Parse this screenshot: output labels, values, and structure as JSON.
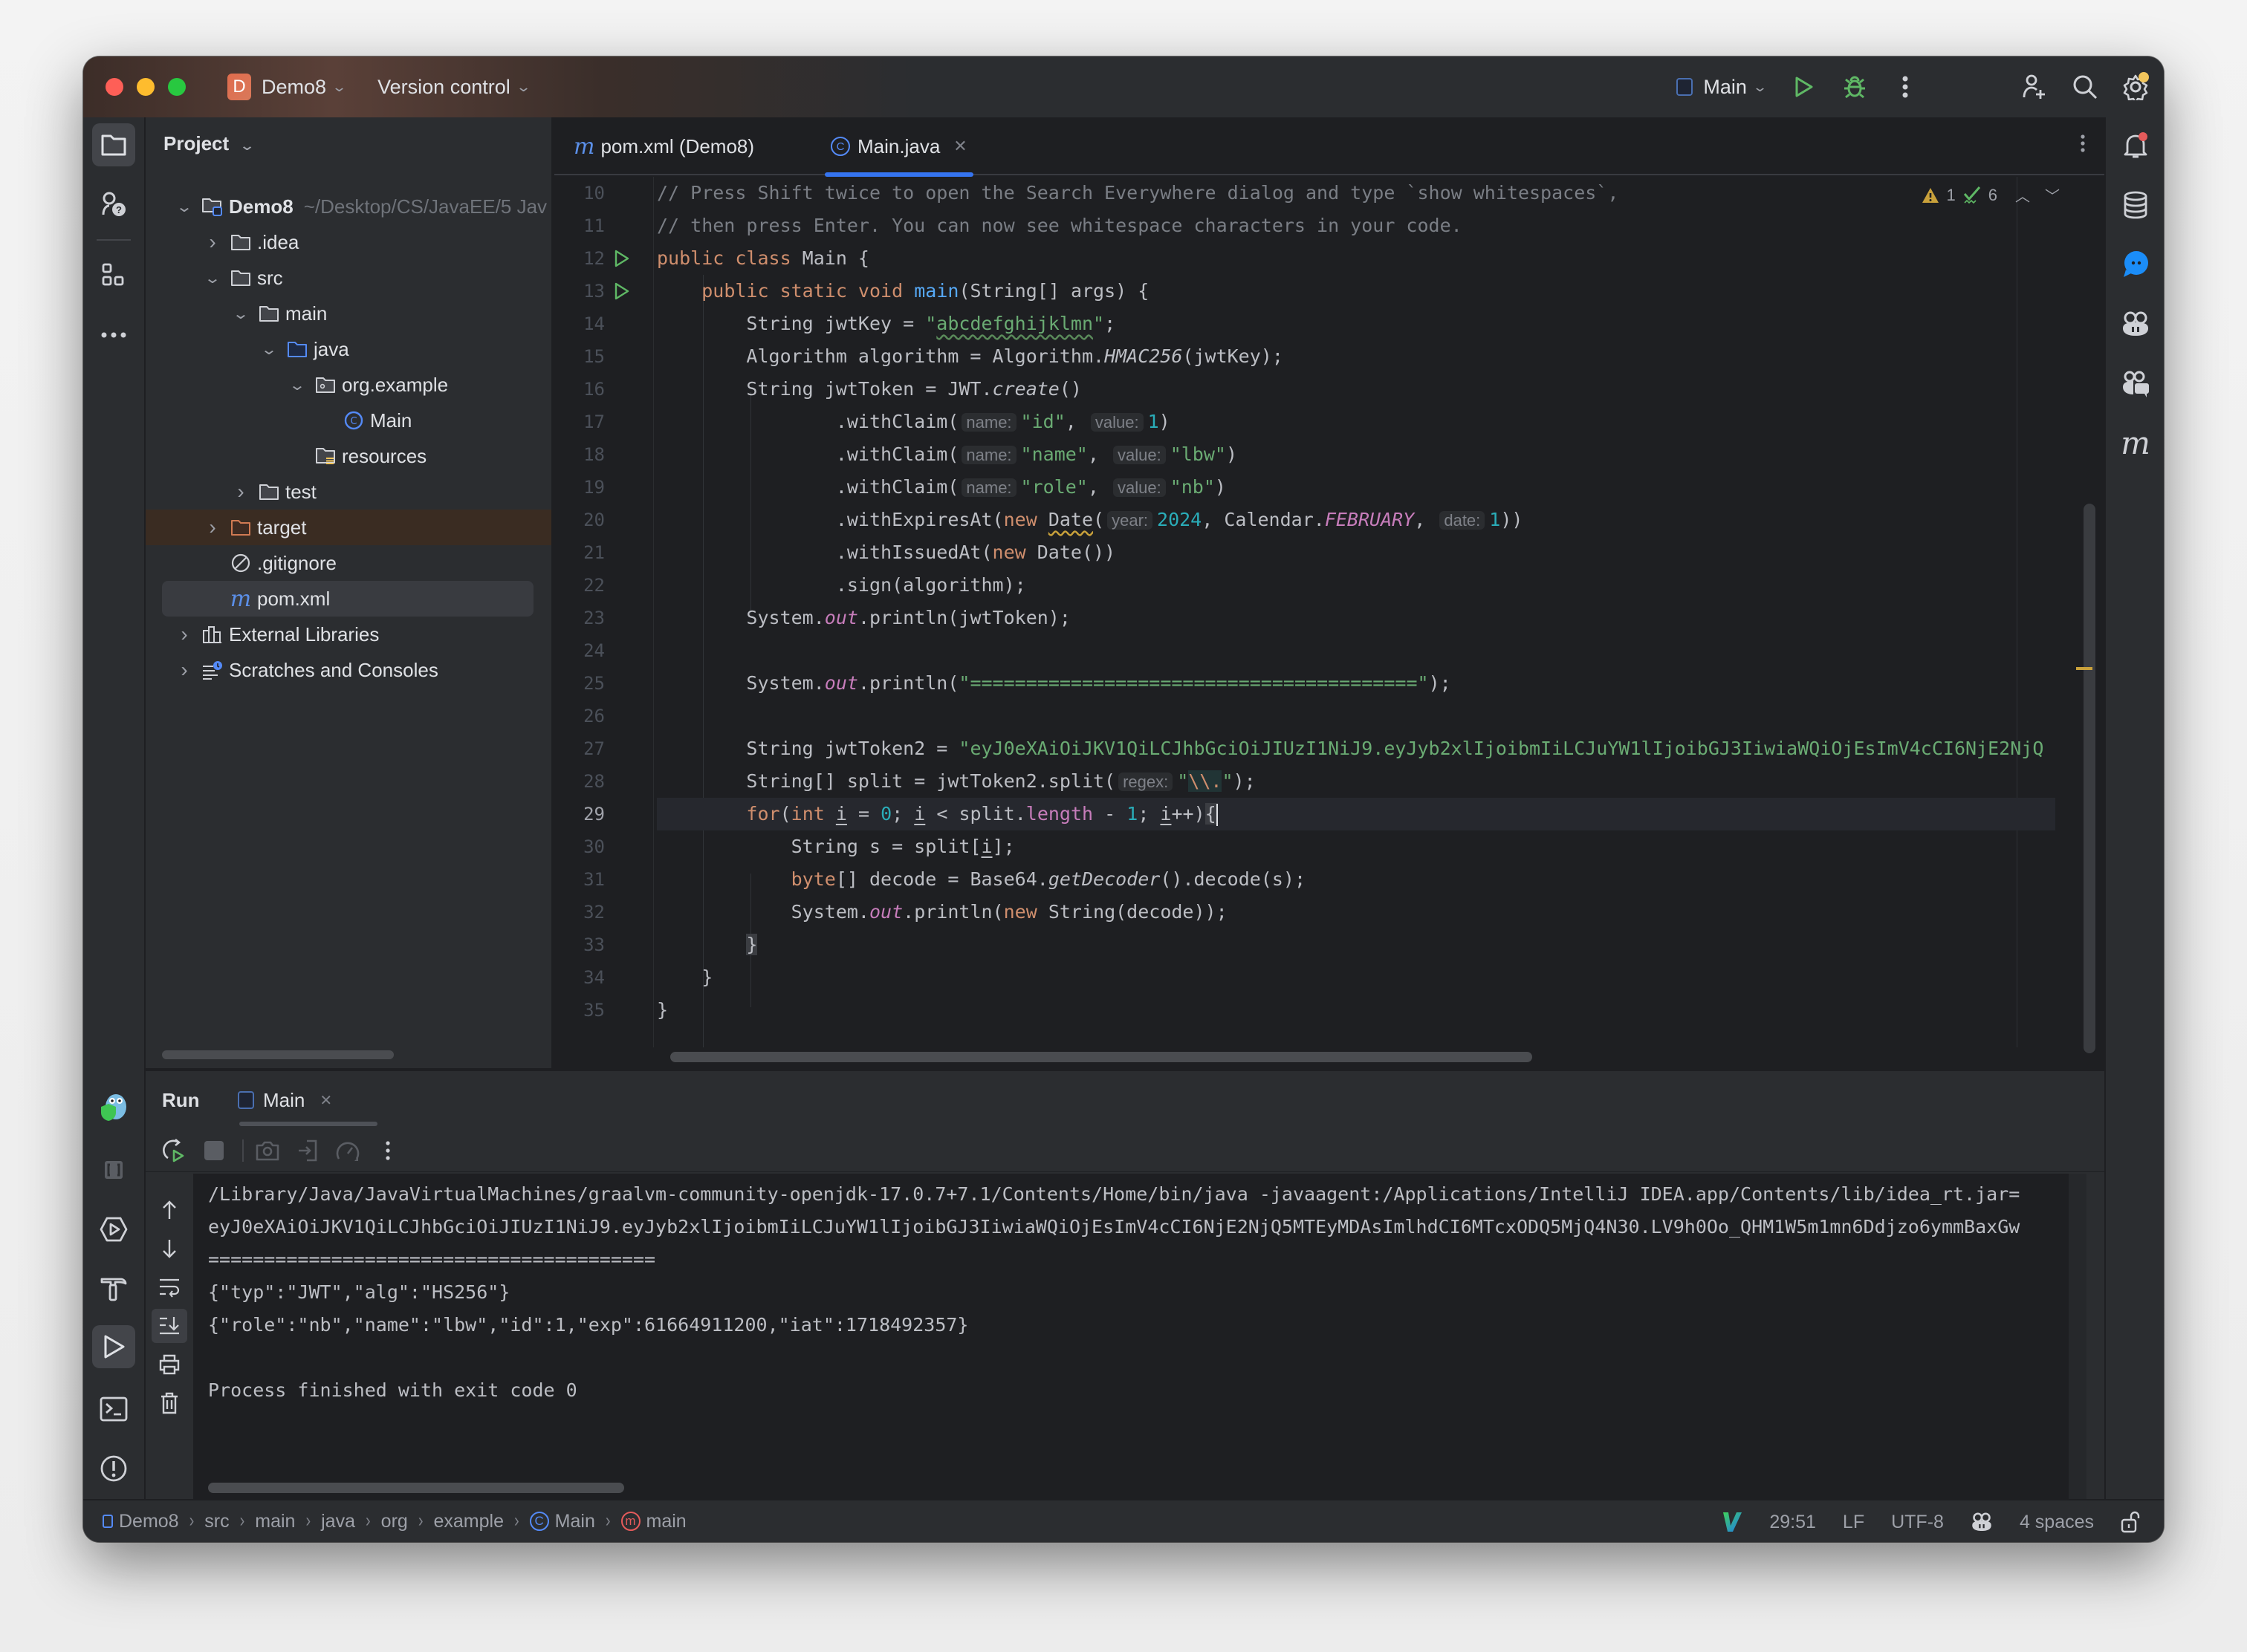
{
  "titlebar": {
    "project_badge": "D",
    "project_name": "Demo8",
    "vcs_label": "Version control",
    "run_config": "Main",
    "actions": [
      "run-icon",
      "debug-icon",
      "more-icon",
      "add-user-icon",
      "search-icon",
      "settings-icon"
    ]
  },
  "left_strip": {
    "items": [
      "project-icon",
      "learn-icon",
      "structure-icon",
      "more-icon",
      "gopher-plugin-icon",
      "bookmarks-icon",
      "services-icon",
      "build-icon",
      "run-icon",
      "terminal-icon",
      "problems-icon",
      "git-icon"
    ]
  },
  "project_panel": {
    "title": "Project",
    "tree": [
      {
        "label": "Demo8",
        "path": "~/Desktop/CS/JavaEE/5 Jav",
        "depth": 0,
        "expanded": true,
        "icon": "module-folder-icon",
        "bold": true
      },
      {
        "label": ".idea",
        "depth": 1,
        "expanded": false,
        "icon": "folder-icon"
      },
      {
        "label": "src",
        "depth": 1,
        "expanded": true,
        "icon": "folder-icon"
      },
      {
        "label": "main",
        "depth": 2,
        "expanded": true,
        "icon": "folder-icon"
      },
      {
        "label": "java",
        "depth": 3,
        "expanded": true,
        "icon": "source-folder-icon"
      },
      {
        "label": "org.example",
        "depth": 4,
        "expanded": true,
        "icon": "package-icon"
      },
      {
        "label": "Main",
        "depth": 5,
        "icon": "class-icon"
      },
      {
        "label": "resources",
        "depth": 4,
        "icon": "resources-folder-icon"
      },
      {
        "label": "test",
        "depth": 2,
        "expanded": false,
        "icon": "folder-icon"
      },
      {
        "label": "target",
        "depth": 1,
        "expanded": false,
        "icon": "excluded-folder-icon",
        "excluded": true
      },
      {
        "label": ".gitignore",
        "depth": 1,
        "icon": "ignore-file-icon"
      },
      {
        "label": "pom.xml",
        "depth": 1,
        "icon": "maven-icon",
        "selected": true
      },
      {
        "label": "External Libraries",
        "depth": 0,
        "expanded": false,
        "icon": "libraries-icon"
      },
      {
        "label": "Scratches and Consoles",
        "depth": 0,
        "expanded": false,
        "icon": "scratches-icon"
      }
    ]
  },
  "editor": {
    "tabs": [
      {
        "label": "pom.xml (Demo8)",
        "icon": "maven-icon",
        "active": false
      },
      {
        "label": "Main.java",
        "icon": "class-icon",
        "active": true,
        "closable": true
      }
    ],
    "inspections": {
      "warnings": "1",
      "typos": "6"
    },
    "current_line": 29,
    "lines": [
      {
        "n": 10,
        "text": "// Press Shift twice to open the Search Everywhere dialog and type `show whitespaces`,"
      },
      {
        "n": 11,
        "text": "// then press Enter. You can now see whitespace characters in your code."
      },
      {
        "n": 12,
        "text": "public class Main {"
      },
      {
        "n": 13,
        "text": "    public static void main(String[] args) {"
      },
      {
        "n": 14,
        "text": "        String jwtKey = \"abcdefghijklmn\";"
      },
      {
        "n": 15,
        "text": "        Algorithm algorithm = Algorithm.HMAC256(jwtKey);"
      },
      {
        "n": 16,
        "text": "        String jwtToken = JWT.create()"
      },
      {
        "n": 17,
        "text": "                .withClaim(name: \"id\", value: 1)"
      },
      {
        "n": 18,
        "text": "                .withClaim(name: \"name\", value: \"lbw\")"
      },
      {
        "n": 19,
        "text": "                .withClaim(name: \"role\", value: \"nb\")"
      },
      {
        "n": 20,
        "text": "                .withExpiresAt(new Date(year: 2024, Calendar.FEBRUARY, date: 1))"
      },
      {
        "n": 21,
        "text": "                .withIssuedAt(new Date())"
      },
      {
        "n": 22,
        "text": "                .sign(algorithm);"
      },
      {
        "n": 23,
        "text": "        System.out.println(jwtToken);"
      },
      {
        "n": 24,
        "text": ""
      },
      {
        "n": 25,
        "text": "        System.out.println(\"========================================\");"
      },
      {
        "n": 26,
        "text": ""
      },
      {
        "n": 27,
        "text": "        String jwtToken2 = \"eyJ0eXAiOiJKV1QiLCJhbGciOiJIUzI1NiJ9.eyJyb2xlIjoibmIiLCJuYW1lIjoibGJ3IiwiaWQiOjEsImV4cCI6NjE2NjQ"
      },
      {
        "n": 28,
        "text": "        String[] split = jwtToken2.split(regex: \"\\\\.\");"
      },
      {
        "n": 29,
        "text": "        for(int i = 0; i < split.length - 1; i++){"
      },
      {
        "n": 30,
        "text": "            String s = split[i];"
      },
      {
        "n": 31,
        "text": "            byte[] decode = Base64.getDecoder().decode(s);"
      },
      {
        "n": 32,
        "text": "            System.out.println(new String(decode));"
      },
      {
        "n": 33,
        "text": "        }"
      },
      {
        "n": 34,
        "text": "    }"
      },
      {
        "n": 35,
        "text": "}"
      }
    ],
    "tokens": {
      "l10": "// Press Shift twice to open the Search Everywhere dialog and type `show whitespaces`,",
      "l11": "// then press Enter. You can now see whitespace characters in your code.",
      "jwtKey_value": "abcdefghijklmn",
      "hmac": "HMAC256",
      "create": "create",
      "claims": [
        {
          "name": "\"id\"",
          "value": "1",
          "value_type": "num"
        },
        {
          "name": "\"name\"",
          "value": "\"lbw\"",
          "value_type": "str"
        },
        {
          "name": "\"role\"",
          "value": "\"nb\"",
          "value_type": "str"
        }
      ],
      "hint_name": "name:",
      "hint_value": "value:",
      "hint_year": "year:",
      "hint_date": "date:",
      "hint_regex": "regex:",
      "year": "2024",
      "month": "FEBRUARY",
      "day": "1",
      "separator": "\"========================================\"",
      "jwt2": "\"eyJ0eXAiOiJKV1QiLCJhbGciOiJIUzI1NiJ9.eyJyb2xlIjoibmIiLCJuYW1lIjoibGJ3IiwiaWQiOjEsImV4cCI6NjE2NjQ"
    }
  },
  "run_panel": {
    "title": "Run",
    "tab_label": "Main",
    "toolbar": [
      "rerun-icon",
      "stop-icon",
      "screenshot-icon",
      "exit-icon",
      "profiler-icon",
      "more-icon"
    ],
    "side_actions": [
      "scroll-up-icon",
      "scroll-down-icon",
      "soft-wrap-icon",
      "scroll-to-end-icon",
      "print-icon",
      "clear-icon"
    ],
    "output": [
      "/Library/Java/JavaVirtualMachines/graalvm-community-openjdk-17.0.7+7.1/Contents/Home/bin/java -javaagent:/Applications/IntelliJ IDEA.app/Contents/lib/idea_rt.jar=",
      "eyJ0eXAiOiJKV1QiLCJhbGciOiJIUzI1NiJ9.eyJyb2xlIjoibmIiLCJuYW1lIjoibGJ3IiwiaWQiOjEsImV4cCI6NjE2NjQ5MTEyMDAsImlhdCI6MTcxODQ5MjQ4N30.LV9h0Oo_QHM1W5m1mn6Ddjzo6ymmBaxGw",
      "========================================",
      "{\"typ\":\"JWT\",\"alg\":\"HS256\"}",
      "{\"role\":\"nb\",\"name\":\"lbw\",\"id\":1,\"exp\":61664911200,\"iat\":1718492357}",
      "",
      "Process finished with exit code 0"
    ]
  },
  "right_strip": {
    "items": [
      "notifications-icon",
      "database-icon",
      "chat-icon",
      "copilot-icon",
      "copilot-chat-icon",
      "maven-icon"
    ]
  },
  "statusbar": {
    "breadcrumbs": [
      "Demo8",
      "src",
      "main",
      "java",
      "org",
      "example",
      "Main",
      "main"
    ],
    "position": "29:51",
    "line_ending": "LF",
    "encoding": "UTF-8",
    "indent": "4 spaces"
  },
  "colors": {
    "accent": "#3574f0",
    "run_green": "#5fb865",
    "keyword": "#cf8e6d",
    "string": "#6aab73",
    "number": "#2aacb8",
    "static": "#c77dbb",
    "function": "#56a8f5",
    "warning": "#c9a13b"
  }
}
